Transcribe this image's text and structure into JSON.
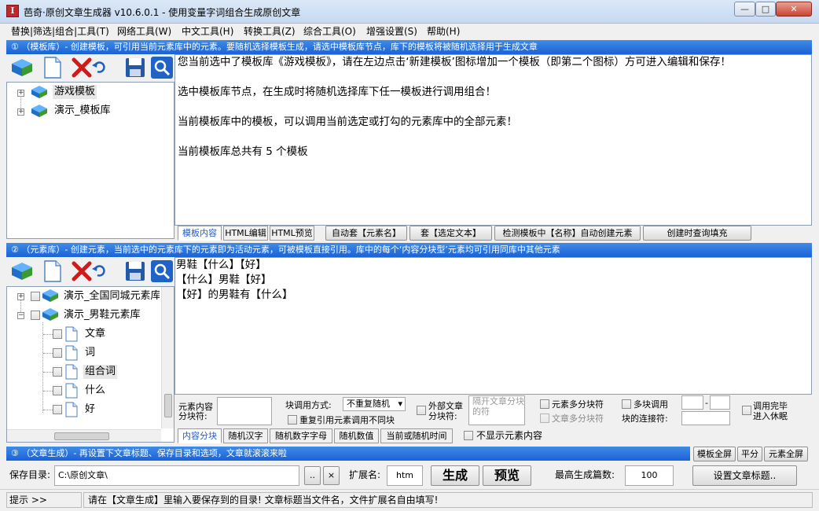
{
  "window": {
    "app_icon_letter": "I",
    "title": "芭奇·原创文章生成器 v10.6.0.1 - 使用变量字词组合生成原创文章",
    "min_glyph": "—",
    "max_glyph": "□",
    "close_glyph": "✕"
  },
  "menu": [
    "替换|筛选|组合|工具(T)",
    "网络工具(W)",
    "中文工具(H)",
    "转换工具(Z)",
    "综合工具(O)",
    "增强设置(S)",
    "帮助(H)"
  ],
  "section1": {
    "header": "① （模板库）- 创建模板，可引用当前元素库中的元素。要随机选择模板生成，请选中模板库节点，库下的模板将被随机选择用于生成文章",
    "tree": [
      "游戏模板",
      "演示_模板库"
    ],
    "content": "您当前选中了模板库《游戏模板》，请在左边点击‘新建模板’图标增加一个模板（即第二个图标）方可进入编辑和保存！\n\n选中模板库节点，在生成时将随机选择库下任一模板进行调用组合！\n\n当前模板库中的模板，可以调用当前选定或打勾的元素库中的全部元素！\n\n当前模板库总共有 5 个模板",
    "tabs": [
      "模板内容",
      "HTML编辑",
      "HTML预览"
    ],
    "buttons": [
      "自动套【元素名】",
      "套【选定文本】",
      "检测模板中【名称】自动创建元素",
      "创建时查询填充"
    ]
  },
  "section2": {
    "header": "② （元素库）- 创建元素，当前选中的元素库下的元素即为活动元素，可被模板直接引用。库中的每个‘内容分块型’元素均可引用同库中其他元素",
    "tree": [
      "演示_全国同城元素库",
      "演示_男鞋元素库"
    ],
    "children": [
      "文章",
      "词",
      "组合词",
      "什么",
      "好"
    ],
    "content": "男鞋【什么】【好】\n【什么】男鞋【好】\n【好】的男鞋有【什么】",
    "opt_block_label_1": "元素内容",
    "opt_block_label_2": "分块符:",
    "opt_call_mode_label": "块调用方式:",
    "opt_call_mode_value": "不重复随机",
    "opt_repeat": "重复引用元素调用不同块",
    "opt_external_1": "外部文章",
    "opt_external_2": "分块符:",
    "opt_external_placeholder": "隔开文章分块的符",
    "opt_multi_block": "元素多分块符",
    "opt_article_multi": "文章多分块符",
    "opt_multi_call": "多块调用",
    "opt_connector": "块的连接符:",
    "opt_dash": "-",
    "opt_finish_1": "调用完毕",
    "opt_finish_2": "进入休眠",
    "tabs": [
      "内容分块",
      "随机汉字",
      "随机数字字母",
      "随机数值",
      "当前或随机时间"
    ],
    "hide_content": "不显示元素内容"
  },
  "section3": {
    "header": "③ （文章生成）- 再设置下文章标题、保存目录和选项，文章就滚滚来啦",
    "view_buttons": [
      "模板全屏",
      "平分",
      "元素全屏"
    ],
    "save_dir_label": "保存目录:",
    "save_dir_value": "C:\\原创文章\\",
    "browse": "..",
    "clear": "×",
    "ext_label": "扩展名:",
    "ext_value": "htm",
    "generate": "生成",
    "preview": "预览",
    "max_label": "最高生成篇数:",
    "max_value": "100",
    "set_title": "设置文章标题.."
  },
  "status": {
    "label": "提示 >>",
    "text": "请在【文章生成】里输入要保存到的目录! 文章标题当文件名，文件扩展名自由填写!"
  },
  "colors": {
    "blue_bar": "#1b62d6",
    "active_tab_text": "#1e5bd0"
  }
}
